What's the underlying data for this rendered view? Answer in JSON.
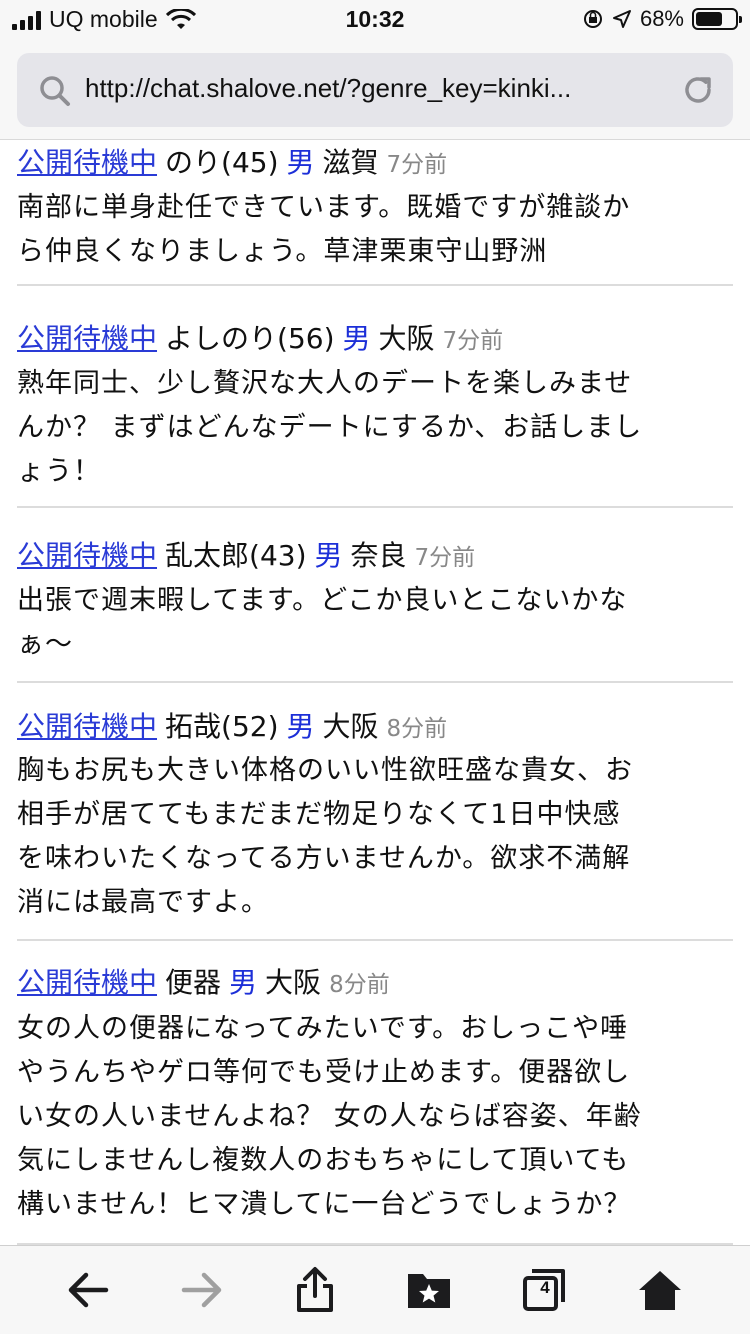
{
  "status_bar": {
    "carrier": "UQ mobile",
    "time": "10:32",
    "battery_percent": "68%",
    "battery_level": 0.68
  },
  "browser": {
    "url": "http://chat.shalove.net/?genre_key=kinki..."
  },
  "posts": [
    {
      "status": "公開待機中",
      "name": "のり(45)",
      "gender": "男",
      "area": "滋賀",
      "time": "7分前",
      "lines": [
        "南部に単身赴任できています。既婚ですが雑談か",
        "ら仲良くなりましょう。草津栗東守山野洲"
      ]
    },
    {
      "status": "公開待機中",
      "name": "よしのり(56)",
      "gender": "男",
      "area": "大阪",
      "time": "7分前",
      "lines": [
        "熟年同士、少し贅沢な大人のデートを楽しみませ",
        "んか？ まずはどんなデートにするか、お話しまし",
        "ょう！"
      ]
    },
    {
      "status": "公開待機中",
      "name": "乱太郎(43)",
      "gender": "男",
      "area": "奈良",
      "time": "7分前",
      "lines": [
        "出張で週末暇してます。どこか良いとこないかな",
        "ぁ〜"
      ]
    },
    {
      "status": "公開待機中",
      "name": "拓哉(52)",
      "gender": "男",
      "area": "大阪",
      "time": "8分前",
      "lines": [
        "胸もお尻も大きい体格のいい性欲旺盛な貴女、お",
        "相手が居ててもまだまだ物足りなくて1日中快感",
        "を味わいたくなってる方いませんか。欲求不満解",
        "消には最高ですよ。"
      ]
    },
    {
      "status": "公開待機中",
      "name": "便器",
      "gender": "男",
      "area": "大阪",
      "time": "8分前",
      "lines": [
        "女の人の便器になってみたいです。おしっこや唾",
        "やうんちやゲロ等何でも受け止めます。便器欲し",
        "い女の人いませんよね？ 女の人ならば容姿、年齢",
        "気にしませんし複数人のおもちゃにして頂いても",
        "構いません！ヒマ潰してに一台どうでしょうか？"
      ]
    }
  ],
  "toolbar": {
    "tab_count": "4"
  },
  "colors": {
    "link": "#2a3bd6",
    "gender": "#1c2fd8",
    "time": "#888888",
    "forward_disabled": "#a0a0a0"
  }
}
